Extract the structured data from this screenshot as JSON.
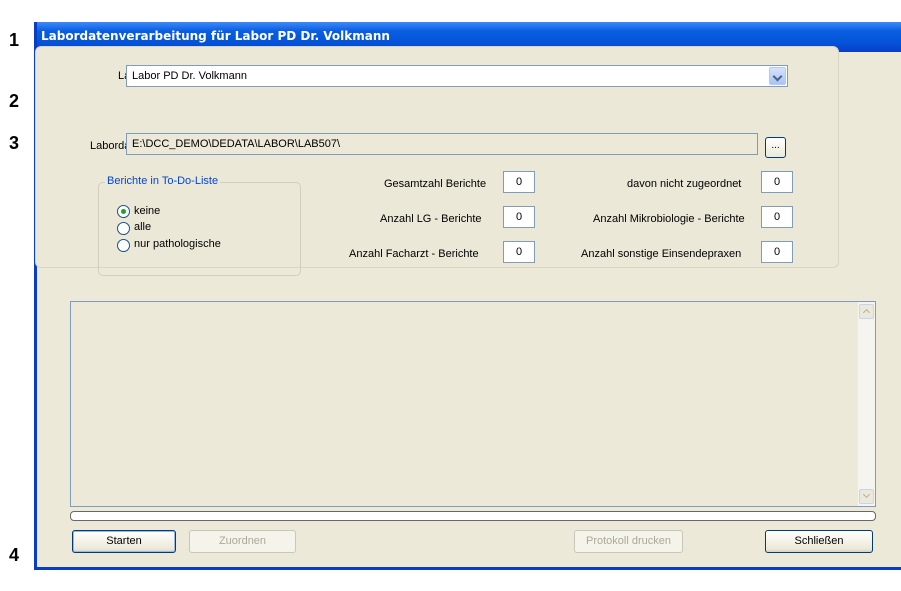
{
  "annotations": [
    "1",
    "2",
    "3",
    "4"
  ],
  "window": {
    "title": "Labordatenverarbeitung für Labor PD Dr. Volkmann"
  },
  "labor": {
    "label": "Labor",
    "value": "Labor PD Dr. Volkmann"
  },
  "labordatei": {
    "label": "Labordatei",
    "value": "E:\\DCC_DEMO\\DEDATA\\LABOR\\LAB507\\",
    "browse_label": "..."
  },
  "todo": {
    "legend": "Berichte in To-Do-Liste",
    "options": [
      {
        "label": "keine",
        "selected": true
      },
      {
        "label": "alle",
        "selected": false
      },
      {
        "label": "nur pathologische",
        "selected": false
      }
    ]
  },
  "stats": [
    {
      "label": "Gesamtzahl Berichte",
      "value": "0"
    },
    {
      "label": "Anzahl LG - Berichte",
      "value": "0"
    },
    {
      "label": "Anzahl Facharzt - Berichte",
      "value": "0"
    },
    {
      "label": "davon nicht zugeordnet",
      "value": "0"
    },
    {
      "label": "Anzahl Mikrobiologie - Berichte",
      "value": "0"
    },
    {
      "label": "Anzahl sonstige Einsendepraxen",
      "value": "0"
    }
  ],
  "progress": 0,
  "buttons": {
    "starten": "Starten",
    "zuordnen": "Zuordnen",
    "protokoll": "Protokoll drucken",
    "schliessen": "Schließen"
  },
  "colors": {
    "titlebar": "#0a5ee0",
    "groupLegend": "#0046d5",
    "radioDot": "#21a121"
  }
}
